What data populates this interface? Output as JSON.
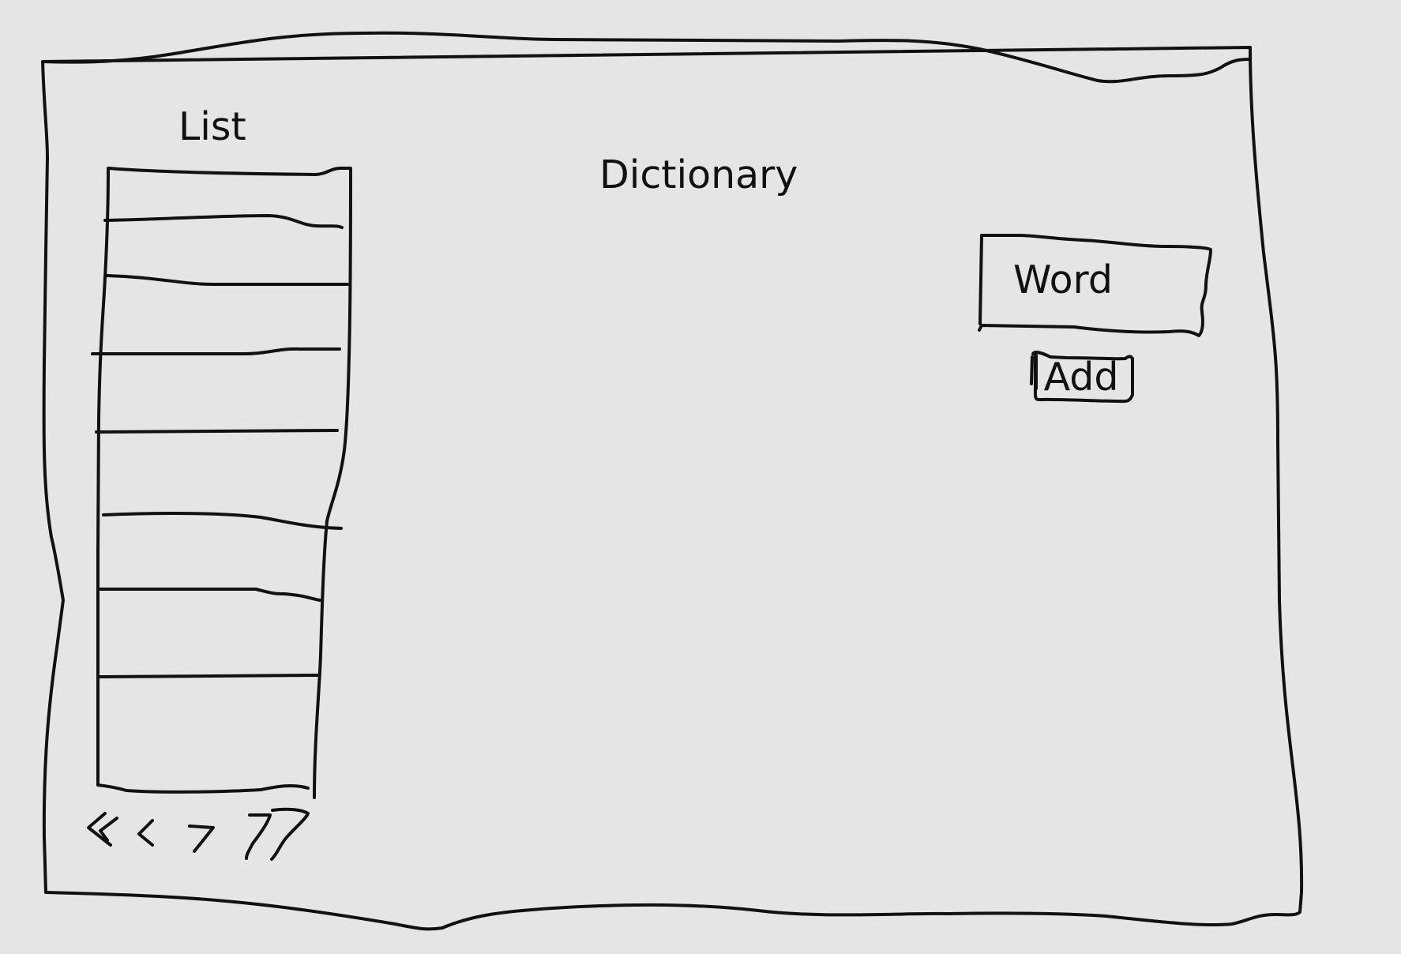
{
  "list": {
    "title": "List",
    "rows": [
      "",
      "",
      "",
      "",
      "",
      "",
      "",
      ""
    ]
  },
  "header": {
    "title": "Dictionary"
  },
  "form": {
    "word_placeholder": "Word",
    "add_label": "Add"
  },
  "pagination": {
    "first_icon": "double-chevron-left-icon",
    "prev_icon": "chevron-left-icon",
    "next_icon": "chevron-right-icon",
    "last_icon": "double-chevron-right-icon"
  },
  "colors": {
    "background": "#e5e5e5",
    "stroke": "#111111"
  }
}
